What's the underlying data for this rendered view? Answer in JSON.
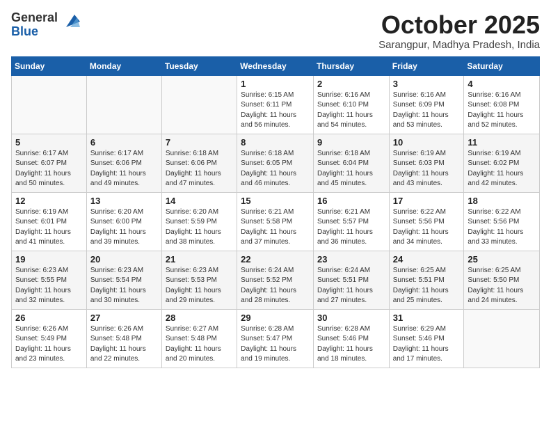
{
  "header": {
    "logo_general": "General",
    "logo_blue": "Blue",
    "month": "October 2025",
    "location": "Sarangpur, Madhya Pradesh, India"
  },
  "columns": [
    "Sunday",
    "Monday",
    "Tuesday",
    "Wednesday",
    "Thursday",
    "Friday",
    "Saturday"
  ],
  "weeks": [
    [
      {
        "day": "",
        "detail": ""
      },
      {
        "day": "",
        "detail": ""
      },
      {
        "day": "",
        "detail": ""
      },
      {
        "day": "1",
        "detail": "Sunrise: 6:15 AM\nSunset: 6:11 PM\nDaylight: 11 hours\nand 56 minutes."
      },
      {
        "day": "2",
        "detail": "Sunrise: 6:16 AM\nSunset: 6:10 PM\nDaylight: 11 hours\nand 54 minutes."
      },
      {
        "day": "3",
        "detail": "Sunrise: 6:16 AM\nSunset: 6:09 PM\nDaylight: 11 hours\nand 53 minutes."
      },
      {
        "day": "4",
        "detail": "Sunrise: 6:16 AM\nSunset: 6:08 PM\nDaylight: 11 hours\nand 52 minutes."
      }
    ],
    [
      {
        "day": "5",
        "detail": "Sunrise: 6:17 AM\nSunset: 6:07 PM\nDaylight: 11 hours\nand 50 minutes."
      },
      {
        "day": "6",
        "detail": "Sunrise: 6:17 AM\nSunset: 6:06 PM\nDaylight: 11 hours\nand 49 minutes."
      },
      {
        "day": "7",
        "detail": "Sunrise: 6:18 AM\nSunset: 6:06 PM\nDaylight: 11 hours\nand 47 minutes."
      },
      {
        "day": "8",
        "detail": "Sunrise: 6:18 AM\nSunset: 6:05 PM\nDaylight: 11 hours\nand 46 minutes."
      },
      {
        "day": "9",
        "detail": "Sunrise: 6:18 AM\nSunset: 6:04 PM\nDaylight: 11 hours\nand 45 minutes."
      },
      {
        "day": "10",
        "detail": "Sunrise: 6:19 AM\nSunset: 6:03 PM\nDaylight: 11 hours\nand 43 minutes."
      },
      {
        "day": "11",
        "detail": "Sunrise: 6:19 AM\nSunset: 6:02 PM\nDaylight: 11 hours\nand 42 minutes."
      }
    ],
    [
      {
        "day": "12",
        "detail": "Sunrise: 6:19 AM\nSunset: 6:01 PM\nDaylight: 11 hours\nand 41 minutes."
      },
      {
        "day": "13",
        "detail": "Sunrise: 6:20 AM\nSunset: 6:00 PM\nDaylight: 11 hours\nand 39 minutes."
      },
      {
        "day": "14",
        "detail": "Sunrise: 6:20 AM\nSunset: 5:59 PM\nDaylight: 11 hours\nand 38 minutes."
      },
      {
        "day": "15",
        "detail": "Sunrise: 6:21 AM\nSunset: 5:58 PM\nDaylight: 11 hours\nand 37 minutes."
      },
      {
        "day": "16",
        "detail": "Sunrise: 6:21 AM\nSunset: 5:57 PM\nDaylight: 11 hours\nand 36 minutes."
      },
      {
        "day": "17",
        "detail": "Sunrise: 6:22 AM\nSunset: 5:56 PM\nDaylight: 11 hours\nand 34 minutes."
      },
      {
        "day": "18",
        "detail": "Sunrise: 6:22 AM\nSunset: 5:56 PM\nDaylight: 11 hours\nand 33 minutes."
      }
    ],
    [
      {
        "day": "19",
        "detail": "Sunrise: 6:23 AM\nSunset: 5:55 PM\nDaylight: 11 hours\nand 32 minutes."
      },
      {
        "day": "20",
        "detail": "Sunrise: 6:23 AM\nSunset: 5:54 PM\nDaylight: 11 hours\nand 30 minutes."
      },
      {
        "day": "21",
        "detail": "Sunrise: 6:23 AM\nSunset: 5:53 PM\nDaylight: 11 hours\nand 29 minutes."
      },
      {
        "day": "22",
        "detail": "Sunrise: 6:24 AM\nSunset: 5:52 PM\nDaylight: 11 hours\nand 28 minutes."
      },
      {
        "day": "23",
        "detail": "Sunrise: 6:24 AM\nSunset: 5:51 PM\nDaylight: 11 hours\nand 27 minutes."
      },
      {
        "day": "24",
        "detail": "Sunrise: 6:25 AM\nSunset: 5:51 PM\nDaylight: 11 hours\nand 25 minutes."
      },
      {
        "day": "25",
        "detail": "Sunrise: 6:25 AM\nSunset: 5:50 PM\nDaylight: 11 hours\nand 24 minutes."
      }
    ],
    [
      {
        "day": "26",
        "detail": "Sunrise: 6:26 AM\nSunset: 5:49 PM\nDaylight: 11 hours\nand 23 minutes."
      },
      {
        "day": "27",
        "detail": "Sunrise: 6:26 AM\nSunset: 5:48 PM\nDaylight: 11 hours\nand 22 minutes."
      },
      {
        "day": "28",
        "detail": "Sunrise: 6:27 AM\nSunset: 5:48 PM\nDaylight: 11 hours\nand 20 minutes."
      },
      {
        "day": "29",
        "detail": "Sunrise: 6:28 AM\nSunset: 5:47 PM\nDaylight: 11 hours\nand 19 minutes."
      },
      {
        "day": "30",
        "detail": "Sunrise: 6:28 AM\nSunset: 5:46 PM\nDaylight: 11 hours\nand 18 minutes."
      },
      {
        "day": "31",
        "detail": "Sunrise: 6:29 AM\nSunset: 5:46 PM\nDaylight: 11 hours\nand 17 minutes."
      },
      {
        "day": "",
        "detail": ""
      }
    ]
  ]
}
